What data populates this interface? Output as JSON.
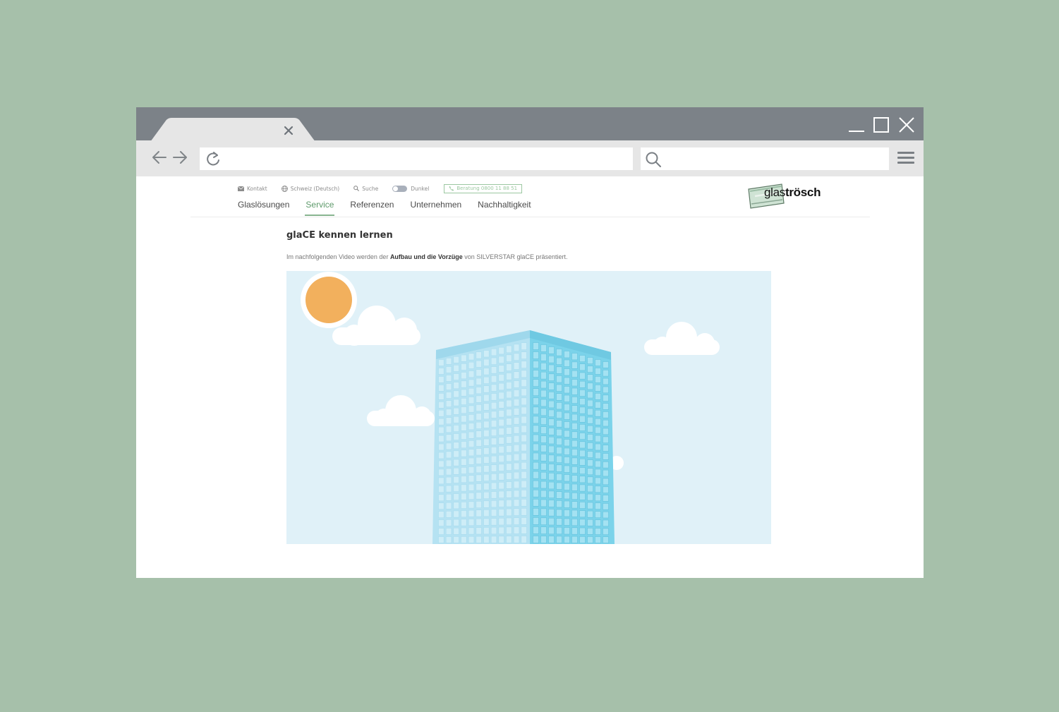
{
  "utility_bar": {
    "contact": "Kontakt",
    "region": "Schweiz (Deutsch)",
    "search": "Suche",
    "dark_mode": "Dunkel",
    "phone": "Beratung 0800 11 88 51"
  },
  "main_nav": {
    "items": [
      "Glaslösungen",
      "Service",
      "Referenzen",
      "Unternehmen",
      "Nachhaltigkeit"
    ],
    "active": "Service"
  },
  "logo": {
    "light": "glas",
    "bold": "trösch"
  },
  "content": {
    "title": "glaCE kennen lernen",
    "intro_before": "Im nachfolgenden Video werden der ",
    "intro_strong": "Aufbau und die Vorzüge",
    "intro_after": " von SILVERSTAR glaCE präsentiert."
  },
  "colors": {
    "background": "#a6c0aa",
    "titlebar": "#7c8288",
    "toolbar": "#e6e6e6",
    "accent_green": "#87b48f",
    "sky": "#e0f1f8",
    "sun": "#f2b05d",
    "building_left": "#b5e2f2",
    "building_right": "#7bd3ea"
  },
  "icons": {
    "tab_close": "close-icon",
    "minimize": "minimize-icon",
    "maximize": "maximize-icon",
    "close": "close-icon",
    "back": "arrow-left-icon",
    "forward": "arrow-right-icon",
    "reload": "reload-icon",
    "search": "search-icon",
    "menu": "hamburger-menu-icon",
    "mail": "mail-icon",
    "globe": "globe-icon",
    "magnifier": "magnifier-icon",
    "phone": "phone-icon"
  }
}
